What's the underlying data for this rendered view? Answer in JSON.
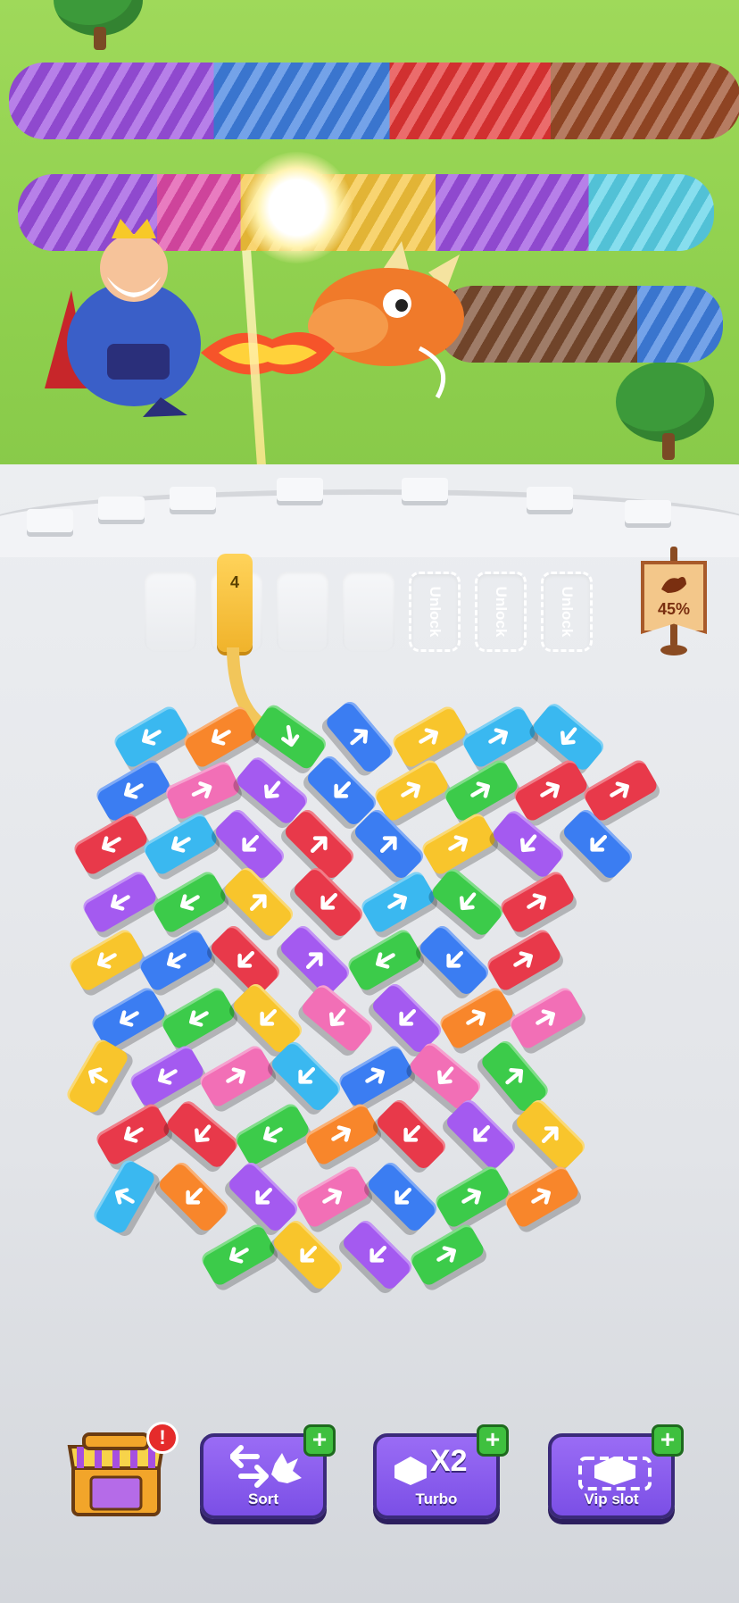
{
  "scene": {
    "characters": [
      "king",
      "dragon"
    ],
    "caterpillar_colors": [
      "#9b4fe0",
      "#3f7fe0",
      "#e33434",
      "#9a4a26",
      "#e04aa8",
      "#f5c33a",
      "#59d1e8",
      "#7a4a2e"
    ]
  },
  "queue": {
    "cannon_count": "4",
    "empty_slots": 4,
    "locked_slots": [
      {
        "label": "Unlock"
      },
      {
        "label": "Unlock"
      },
      {
        "label": "Unlock"
      }
    ]
  },
  "progress": {
    "percent_label": "45%",
    "value": 0.45,
    "icon": "dragon-flag-icon"
  },
  "toolbar": {
    "shop": {
      "icon": "shop-icon",
      "alert": "!"
    },
    "sort": {
      "label": "Sort",
      "plus": "+",
      "icon": "sort-arrows-icon"
    },
    "turbo": {
      "label": "Turbo",
      "plus": "+",
      "multiplier": "X2",
      "icon": "turbo-icon"
    },
    "vip": {
      "label": "Vip slot",
      "plus": "+",
      "icon": "vip-slot-icon"
    }
  },
  "colors": {
    "red": "#e8394a",
    "blue": "#3b7df2",
    "yellow": "#f8c52c",
    "green": "#3ccb4a",
    "purple": "#a45af0",
    "pink": "#f26fb6",
    "orange": "#f8862b",
    "cyan": "#3ab8f0"
  },
  "blocks": [
    {
      "c": "cyan",
      "a": -30,
      "d": 180,
      "r": 0,
      "k": 0
    },
    {
      "c": "orange",
      "a": -30,
      "d": 180,
      "r": 0,
      "k": 1
    },
    {
      "c": "green",
      "a": 35,
      "d": 45,
      "r": 0,
      "k": 2
    },
    {
      "c": "blue",
      "a": 50,
      "d": -90,
      "r": 0,
      "k": 3
    },
    {
      "c": "yellow",
      "a": -30,
      "d": 0,
      "r": 0,
      "k": 4
    },
    {
      "c": "cyan",
      "a": -30,
      "d": 0,
      "r": 0,
      "k": 5
    },
    {
      "c": "cyan",
      "a": 40,
      "d": 90,
      "r": 0,
      "k": 6
    },
    {
      "c": "blue",
      "a": -30,
      "d": 180,
      "r": 1,
      "k": 0
    },
    {
      "c": "pink",
      "a": -25,
      "d": 0,
      "r": 1,
      "k": 1
    },
    {
      "c": "purple",
      "a": 40,
      "d": 90,
      "r": 1,
      "k": 2
    },
    {
      "c": "blue",
      "a": 45,
      "d": 90,
      "r": 1,
      "k": 3
    },
    {
      "c": "yellow",
      "a": -30,
      "d": 0,
      "r": 1,
      "k": 4
    },
    {
      "c": "green",
      "a": -30,
      "d": 0,
      "r": 1,
      "k": 5
    },
    {
      "c": "red",
      "a": -30,
      "d": 0,
      "r": 1,
      "k": 6
    },
    {
      "c": "red",
      "a": -30,
      "d": 0,
      "r": 1,
      "k": 7
    },
    {
      "c": "red",
      "a": -30,
      "d": 180,
      "r": 2,
      "k": 0
    },
    {
      "c": "cyan",
      "a": -30,
      "d": 180,
      "r": 2,
      "k": 1
    },
    {
      "c": "purple",
      "a": 45,
      "d": 90,
      "r": 2,
      "k": 2
    },
    {
      "c": "red",
      "a": 45,
      "d": -90,
      "r": 2,
      "k": 3
    },
    {
      "c": "blue",
      "a": 45,
      "d": -90,
      "r": 2,
      "k": 4
    },
    {
      "c": "yellow",
      "a": -30,
      "d": 0,
      "r": 2,
      "k": 5
    },
    {
      "c": "purple",
      "a": 40,
      "d": 90,
      "r": 2,
      "k": 6
    },
    {
      "c": "blue",
      "a": 45,
      "d": 90,
      "r": 2,
      "k": 7
    },
    {
      "c": "purple",
      "a": -30,
      "d": 180,
      "r": 3,
      "k": 0
    },
    {
      "c": "green",
      "a": -30,
      "d": 180,
      "r": 3,
      "k": 1
    },
    {
      "c": "yellow",
      "a": 45,
      "d": -90,
      "r": 3,
      "k": 2
    },
    {
      "c": "red",
      "a": 45,
      "d": 90,
      "r": 3,
      "k": 3
    },
    {
      "c": "cyan",
      "a": -30,
      "d": 0,
      "r": 3,
      "k": 4
    },
    {
      "c": "green",
      "a": 40,
      "d": 90,
      "r": 3,
      "k": 5
    },
    {
      "c": "red",
      "a": -30,
      "d": 0,
      "r": 3,
      "k": 6
    },
    {
      "c": "yellow",
      "a": -30,
      "d": 180,
      "r": 4,
      "k": 0
    },
    {
      "c": "blue",
      "a": -30,
      "d": 180,
      "r": 4,
      "k": 1
    },
    {
      "c": "red",
      "a": 45,
      "d": 90,
      "r": 4,
      "k": 2
    },
    {
      "c": "purple",
      "a": 45,
      "d": -90,
      "r": 4,
      "k": 3
    },
    {
      "c": "green",
      "a": -30,
      "d": 180,
      "r": 4,
      "k": 4
    },
    {
      "c": "blue",
      "a": 45,
      "d": 90,
      "r": 4,
      "k": 5
    },
    {
      "c": "red",
      "a": -30,
      "d": 0,
      "r": 4,
      "k": 6
    },
    {
      "c": "blue",
      "a": -30,
      "d": 180,
      "r": 5,
      "k": 0
    },
    {
      "c": "green",
      "a": -30,
      "d": 180,
      "r": 5,
      "k": 1
    },
    {
      "c": "yellow",
      "a": 45,
      "d": 90,
      "r": 5,
      "k": 2
    },
    {
      "c": "pink",
      "a": 40,
      "d": 90,
      "r": 5,
      "k": 3
    },
    {
      "c": "purple",
      "a": 45,
      "d": 90,
      "r": 5,
      "k": 4
    },
    {
      "c": "orange",
      "a": -30,
      "d": 0,
      "r": 5,
      "k": 5
    },
    {
      "c": "pink",
      "a": -30,
      "d": 0,
      "r": 5,
      "k": 6
    },
    {
      "c": "yellow",
      "a": -60,
      "d": -90,
      "r": 6,
      "k": 0
    },
    {
      "c": "purple",
      "a": -30,
      "d": 180,
      "r": 6,
      "k": 1
    },
    {
      "c": "pink",
      "a": -30,
      "d": 0,
      "r": 6,
      "k": 2
    },
    {
      "c": "cyan",
      "a": 45,
      "d": 90,
      "r": 6,
      "k": 3
    },
    {
      "c": "blue",
      "a": -30,
      "d": 0,
      "r": 6,
      "k": 4
    },
    {
      "c": "pink",
      "a": 40,
      "d": 90,
      "r": 6,
      "k": 5
    },
    {
      "c": "green",
      "a": 50,
      "d": -90,
      "r": 6,
      "k": 6
    },
    {
      "c": "red",
      "a": -30,
      "d": 180,
      "r": 7,
      "k": 0
    },
    {
      "c": "red",
      "a": 40,
      "d": 90,
      "r": 7,
      "k": 1
    },
    {
      "c": "green",
      "a": -30,
      "d": 180,
      "r": 7,
      "k": 2
    },
    {
      "c": "orange",
      "a": -30,
      "d": 0,
      "r": 7,
      "k": 3
    },
    {
      "c": "red",
      "a": 45,
      "d": 90,
      "r": 7,
      "k": 4
    },
    {
      "c": "purple",
      "a": 45,
      "d": 90,
      "r": 7,
      "k": 5
    },
    {
      "c": "yellow",
      "a": 45,
      "d": -90,
      "r": 7,
      "k": 6
    },
    {
      "c": "cyan",
      "a": -60,
      "d": -90,
      "r": 8,
      "k": 0
    },
    {
      "c": "orange",
      "a": 45,
      "d": 90,
      "r": 8,
      "k": 1
    },
    {
      "c": "purple",
      "a": 45,
      "d": 90,
      "r": 8,
      "k": 2
    },
    {
      "c": "pink",
      "a": -30,
      "d": 0,
      "r": 8,
      "k": 3
    },
    {
      "c": "blue",
      "a": 45,
      "d": 90,
      "r": 8,
      "k": 4
    },
    {
      "c": "green",
      "a": -30,
      "d": 0,
      "r": 8,
      "k": 5
    },
    {
      "c": "orange",
      "a": -30,
      "d": 0,
      "r": 8,
      "k": 6
    },
    {
      "c": "green",
      "a": -30,
      "d": 180,
      "r": 9,
      "k": 1
    },
    {
      "c": "yellow",
      "a": 45,
      "d": 90,
      "r": 9,
      "k": 2
    },
    {
      "c": "purple",
      "a": 45,
      "d": 90,
      "r": 9,
      "k": 3
    },
    {
      "c": "green",
      "a": -30,
      "d": 0,
      "r": 9,
      "k": 4
    }
  ]
}
